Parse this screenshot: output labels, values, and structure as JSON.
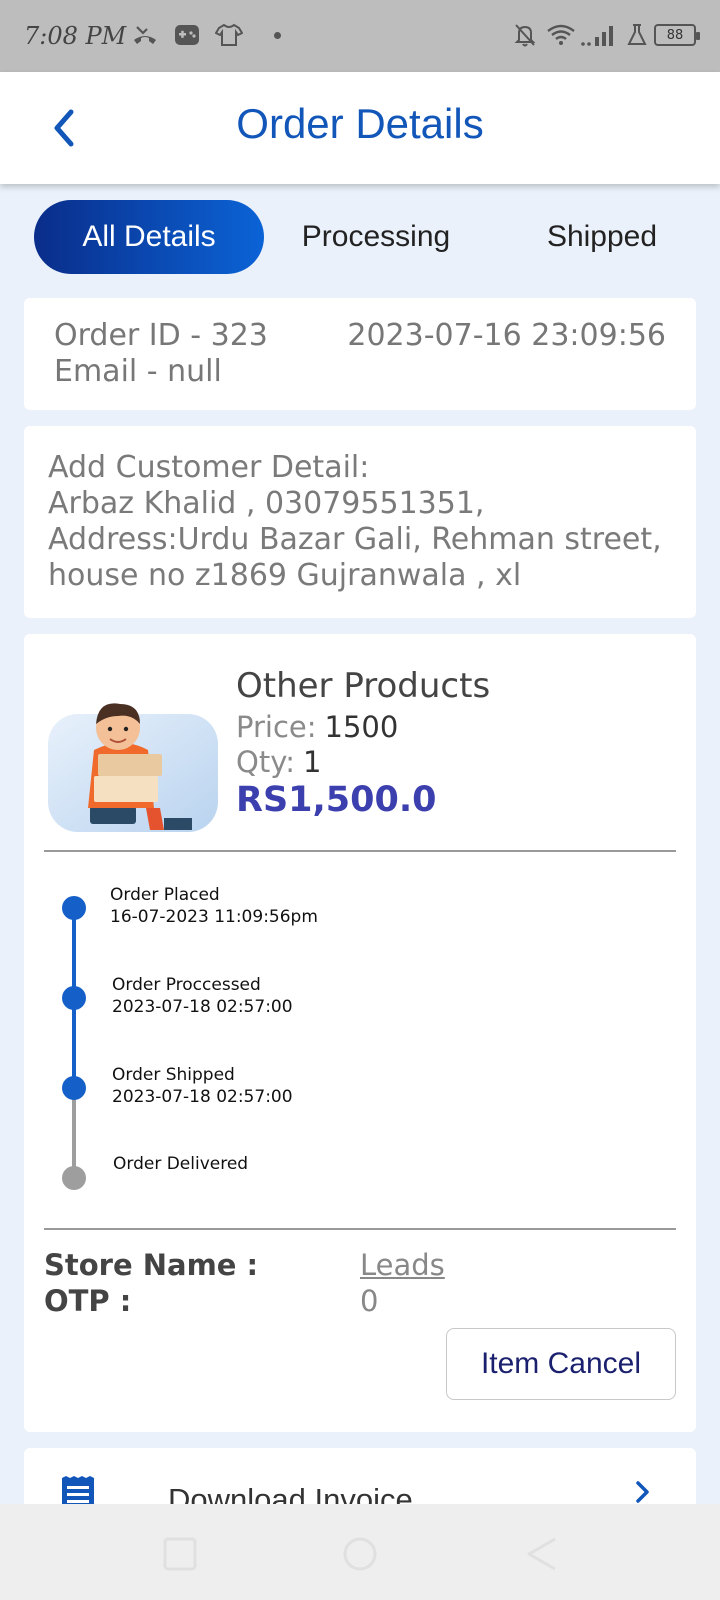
{
  "status_bar": {
    "time": "7:08 PM",
    "battery": "88",
    "icons": [
      "missed-call-icon",
      "game-icon",
      "tshirt-icon",
      "bell-off-icon",
      "wifi-icon",
      "signal-icon",
      "lab-icon"
    ]
  },
  "header": {
    "title": "Order Details",
    "back_icon": "chevron-left-icon"
  },
  "tabs": [
    {
      "label": "All Details",
      "active": true
    },
    {
      "label": "Processing",
      "active": false
    },
    {
      "label": "Shipped",
      "active": false
    }
  ],
  "order": {
    "id_text": "Order ID - 323",
    "email_text": "Email - null",
    "datetime": "2023-07-16 23:09:56"
  },
  "customer": {
    "text": "Add Customer Detail:\nArbaz Khalid , 03079551351,\nAddress:Urdu Bazar Gali, Rehman street,\nhouse no z1869  Gujranwala ,  xl"
  },
  "product": {
    "name": "Other Products",
    "price_label": "Price:",
    "price": "1500",
    "qty_label": "Qty:",
    "qty": "1",
    "total": "RS1,500.0",
    "image": "delivery-person-illustration"
  },
  "timeline": [
    {
      "title": "Order Placed",
      "date": "16-07-2023 11:09:56pm",
      "done": true
    },
    {
      "title": "Order Proccessed",
      "date": "2023-07-18 02:57:00",
      "done": true
    },
    {
      "title": "Order Shipped",
      "date": "2023-07-18 02:57:00",
      "done": true
    },
    {
      "title": "Order Delivered",
      "date": "",
      "done": false
    }
  ],
  "store": {
    "name_label": "Store Name :",
    "name_value": "Leads",
    "otp_label": "OTP :",
    "otp_value": "0"
  },
  "actions": {
    "cancel_label": "Item Cancel",
    "invoice_label": "Download Invoice"
  },
  "colors": {
    "accent": "#1156b8",
    "tab_gradient_start": "#0a2d8a",
    "tab_gradient_end": "#0b63d6",
    "total": "#3c3fae",
    "timeline_done": "#1560c8",
    "timeline_pending": "#9e9e9e",
    "background": "#ebf1fa"
  }
}
